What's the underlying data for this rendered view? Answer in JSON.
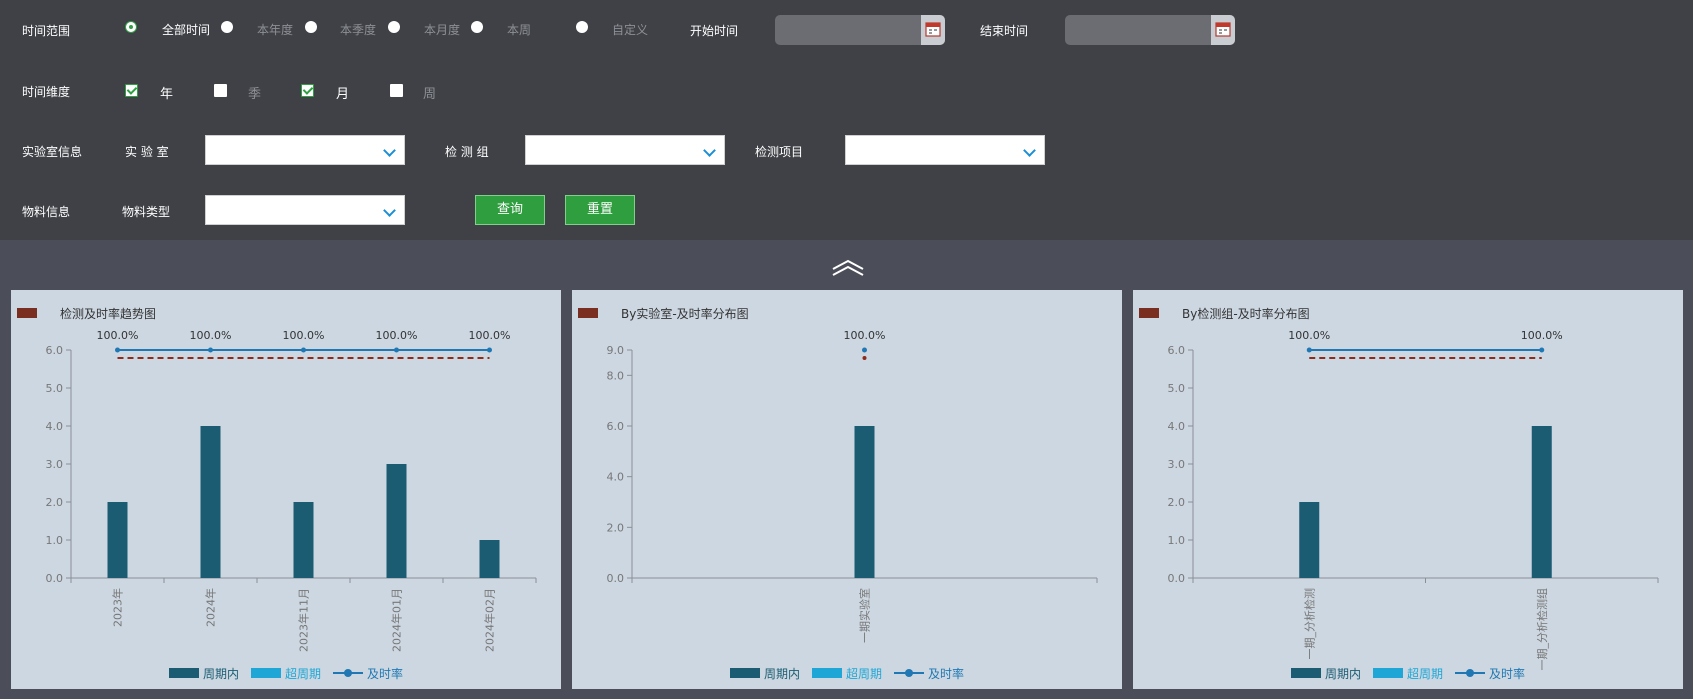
{
  "filters": {
    "time_range_label": "时间范围",
    "time_range_options": [
      "全部时间",
      "本年度",
      "本季度",
      "本月度",
      "本周",
      "自定义"
    ],
    "time_range_selected": "全部时间",
    "start_label": "开始时间",
    "end_label": "结束时间",
    "start_value": "",
    "end_value": "",
    "dimension_label": "时间维度",
    "dimension_options": [
      {
        "label": "年",
        "checked": true
      },
      {
        "label": "季",
        "checked": false
      },
      {
        "label": "月",
        "checked": true
      },
      {
        "label": "周",
        "checked": false
      }
    ],
    "lab_info_label": "实验室信息",
    "lab_label": "实 验 室",
    "group_label": "检 测 组",
    "item_label": "检测项目",
    "material_info_label": "物料信息",
    "material_type_label": "物料类型",
    "lab_value": "",
    "group_value": "",
    "item_value": "",
    "material_value": "",
    "query_label": "查询",
    "reset_label": "重置"
  },
  "colors": {
    "in_cycle": "#1b5c72",
    "over_cycle": "#1ea7d6",
    "rate": "#1f78b4",
    "target": "#8b2c1c",
    "accent": "#2e9e3e"
  },
  "legend": {
    "in_cycle": "周期内",
    "over_cycle": "超周期",
    "rate": "及时率"
  },
  "chart_data": [
    {
      "type": "bar",
      "title": "检测及时率趋势图",
      "categories": [
        "2023年",
        "2024年",
        "2023年11月",
        "2024年01月",
        "2024年02月"
      ],
      "series": [
        {
          "name": "周期内",
          "values": [
            2,
            4,
            2,
            3,
            1
          ]
        },
        {
          "name": "超周期",
          "values": [
            0,
            0,
            0,
            0,
            0
          ]
        },
        {
          "name": "及时率",
          "values": [
            100,
            100,
            100,
            100,
            100
          ]
        }
      ],
      "rate_labels": [
        "100.0%",
        "100.0%",
        "100.0%",
        "100.0%",
        "100.0%"
      ],
      "ylim": [
        0,
        6
      ],
      "yticks": [
        "0.0",
        "1.0",
        "2.0",
        "3.0",
        "4.0",
        "5.0",
        "6.0"
      ]
    },
    {
      "type": "bar",
      "title": "By实验室-及时率分布图",
      "categories": [
        "一期实验室"
      ],
      "series": [
        {
          "name": "周期内",
          "values": [
            6
          ]
        },
        {
          "name": "超周期",
          "values": [
            0
          ]
        },
        {
          "name": "及时率",
          "values": [
            100
          ]
        }
      ],
      "rate_labels": [
        "100.0%"
      ],
      "ylim": [
        0,
        9
      ],
      "yticks": [
        "0.0",
        "2.0",
        "4.0",
        "6.0",
        "8.0",
        "9.0"
      ]
    },
    {
      "type": "bar",
      "title": "By检测组-及时率分布图",
      "categories": [
        "一期_分析检测",
        "一期_分析检测组"
      ],
      "series": [
        {
          "name": "周期内",
          "values": [
            2,
            4
          ]
        },
        {
          "name": "超周期",
          "values": [
            0,
            0
          ]
        },
        {
          "name": "及时率",
          "values": [
            100,
            100
          ]
        }
      ],
      "rate_labels": [
        "100.0%",
        "100.0%"
      ],
      "ylim": [
        0,
        6
      ],
      "yticks": [
        "0.0",
        "1.0",
        "2.0",
        "3.0",
        "4.0",
        "5.0",
        "6.0"
      ]
    }
  ]
}
